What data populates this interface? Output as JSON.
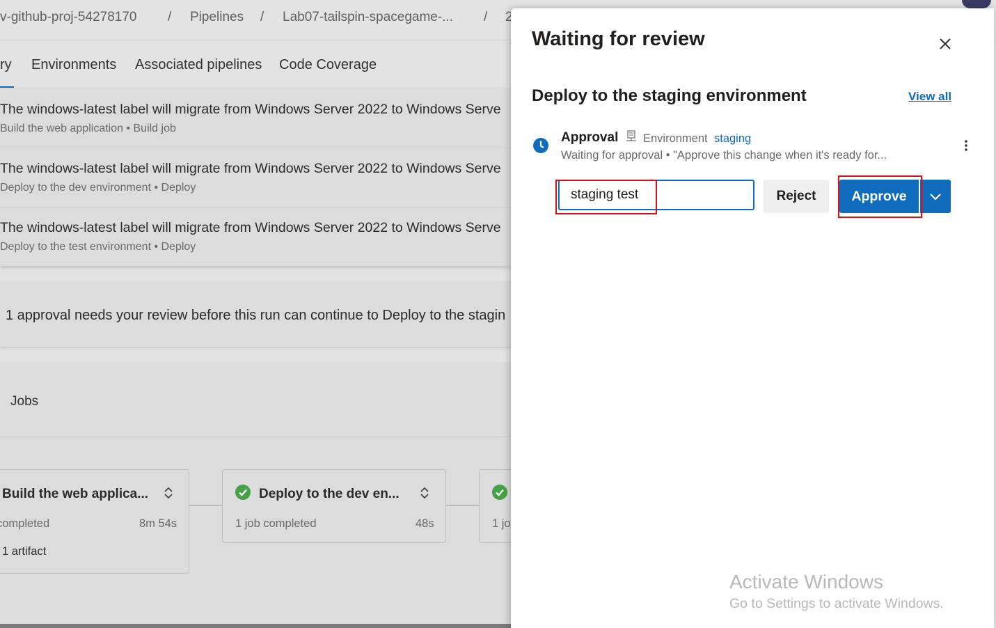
{
  "breadcrumb": {
    "items": [
      "v-github-proj-54278170",
      "Pipelines",
      "Lab07-tailspin-spacegame-...",
      "2"
    ],
    "separator": "/"
  },
  "tabs": [
    {
      "label": "ry",
      "active": true
    },
    {
      "label": "Environments"
    },
    {
      "label": "Associated pipelines"
    },
    {
      "label": "Code Coverage"
    }
  ],
  "warnings": [
    {
      "title": "The windows-latest label will migrate from Windows Server 2022 to Windows Serve",
      "sub": "Build the web application • Build job"
    },
    {
      "title": "The windows-latest label will migrate from Windows Server 2022 to Windows Serve",
      "sub": "Deploy to the dev environment • Deploy"
    },
    {
      "title": "The windows-latest label will migrate from Windows Server 2022 to Windows Serve",
      "sub": "Deploy to the test environment • Deploy"
    }
  ],
  "banner": {
    "text": "1 approval needs your review before this run can continue to Deploy to the stagin"
  },
  "jobs": {
    "title": "Jobs",
    "stages": [
      {
        "name": "Build the web applica...",
        "status": "",
        "duration": "8m 54s",
        "completed": "completed",
        "artifact": "1 artifact"
      },
      {
        "name": "Deploy to the dev en...",
        "status": "succeeded",
        "duration": "48s",
        "completed": "1 job completed"
      },
      {
        "name": "",
        "status": "succeeded",
        "duration": "",
        "completed": "1 jo"
      }
    ]
  },
  "panel": {
    "title": "Waiting for review",
    "section_title": "Deploy to the staging environment",
    "view_all": "View all",
    "approval": {
      "label": "Approval",
      "env_label": "Environment",
      "env_name": "staging",
      "subtitle": "Waiting for approval • \"Approve this change when it's ready for..."
    },
    "comment_value": "staging test",
    "reject_label": "Reject",
    "approve_label": "Approve"
  },
  "watermark": {
    "line1": "Activate Windows",
    "line2": "Go to Settings to activate Windows."
  },
  "colors": {
    "accent": "#0f6cbd",
    "highlight": "#d0121b",
    "success": "#46a046"
  }
}
